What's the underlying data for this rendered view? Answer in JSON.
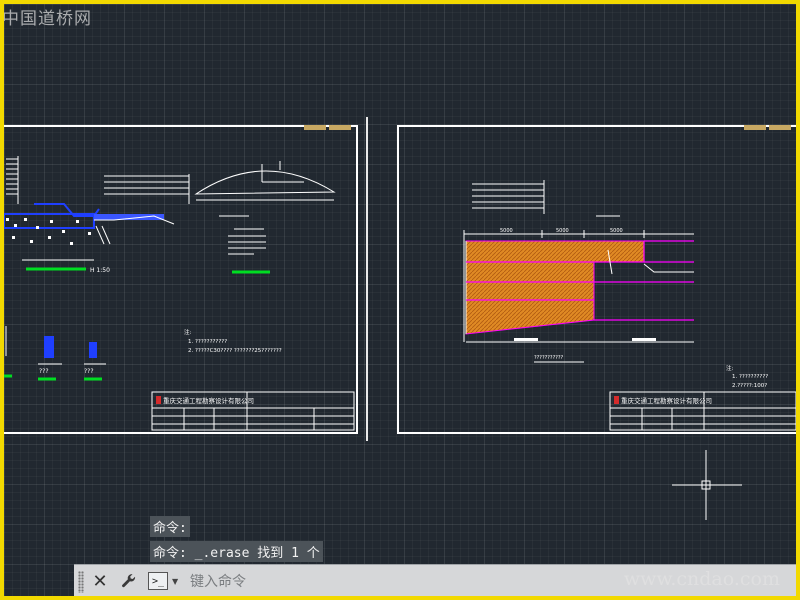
{
  "watermarks": {
    "top_left": "中国道桥网",
    "bottom_right": "www.cndao.com"
  },
  "command_history": [
    "命令:",
    "命令: _.erase 找到 1 个"
  ],
  "command_line": {
    "placeholder": "键入命令",
    "close_symbol": "✕",
    "customize_symbol": "🔧",
    "prompt_symbol": ">_",
    "dropdown_symbol": "▼"
  },
  "drawing_left": {
    "scale_note": "H 1:50",
    "notes_heading": "注:",
    "notes": [
      "1. ???????????",
      "2. ?????C30????  ???????25???????"
    ],
    "title_block_company": "重庆交通工程勘察设计有限公司",
    "dim_labels": [
      "???",
      "???",
      "???",
      "???"
    ]
  },
  "drawing_right": {
    "notes_heading": "注:",
    "notes": [
      "1. ??????????",
      "2.?????:100?"
    ],
    "title_block_company": "重庆交通工程勘察设计有限公司",
    "dims": [
      "5000",
      "5000",
      "5000"
    ],
    "section_caption": "???????????"
  },
  "colors": {
    "canvas_bg": "#212830",
    "frame_border": "#f2d900",
    "sheet_border": "#ffffff",
    "fill_orange": "#e08a24",
    "magenta": "#ff00ff",
    "green": "#00dd22",
    "blue": "#1f3fff"
  }
}
